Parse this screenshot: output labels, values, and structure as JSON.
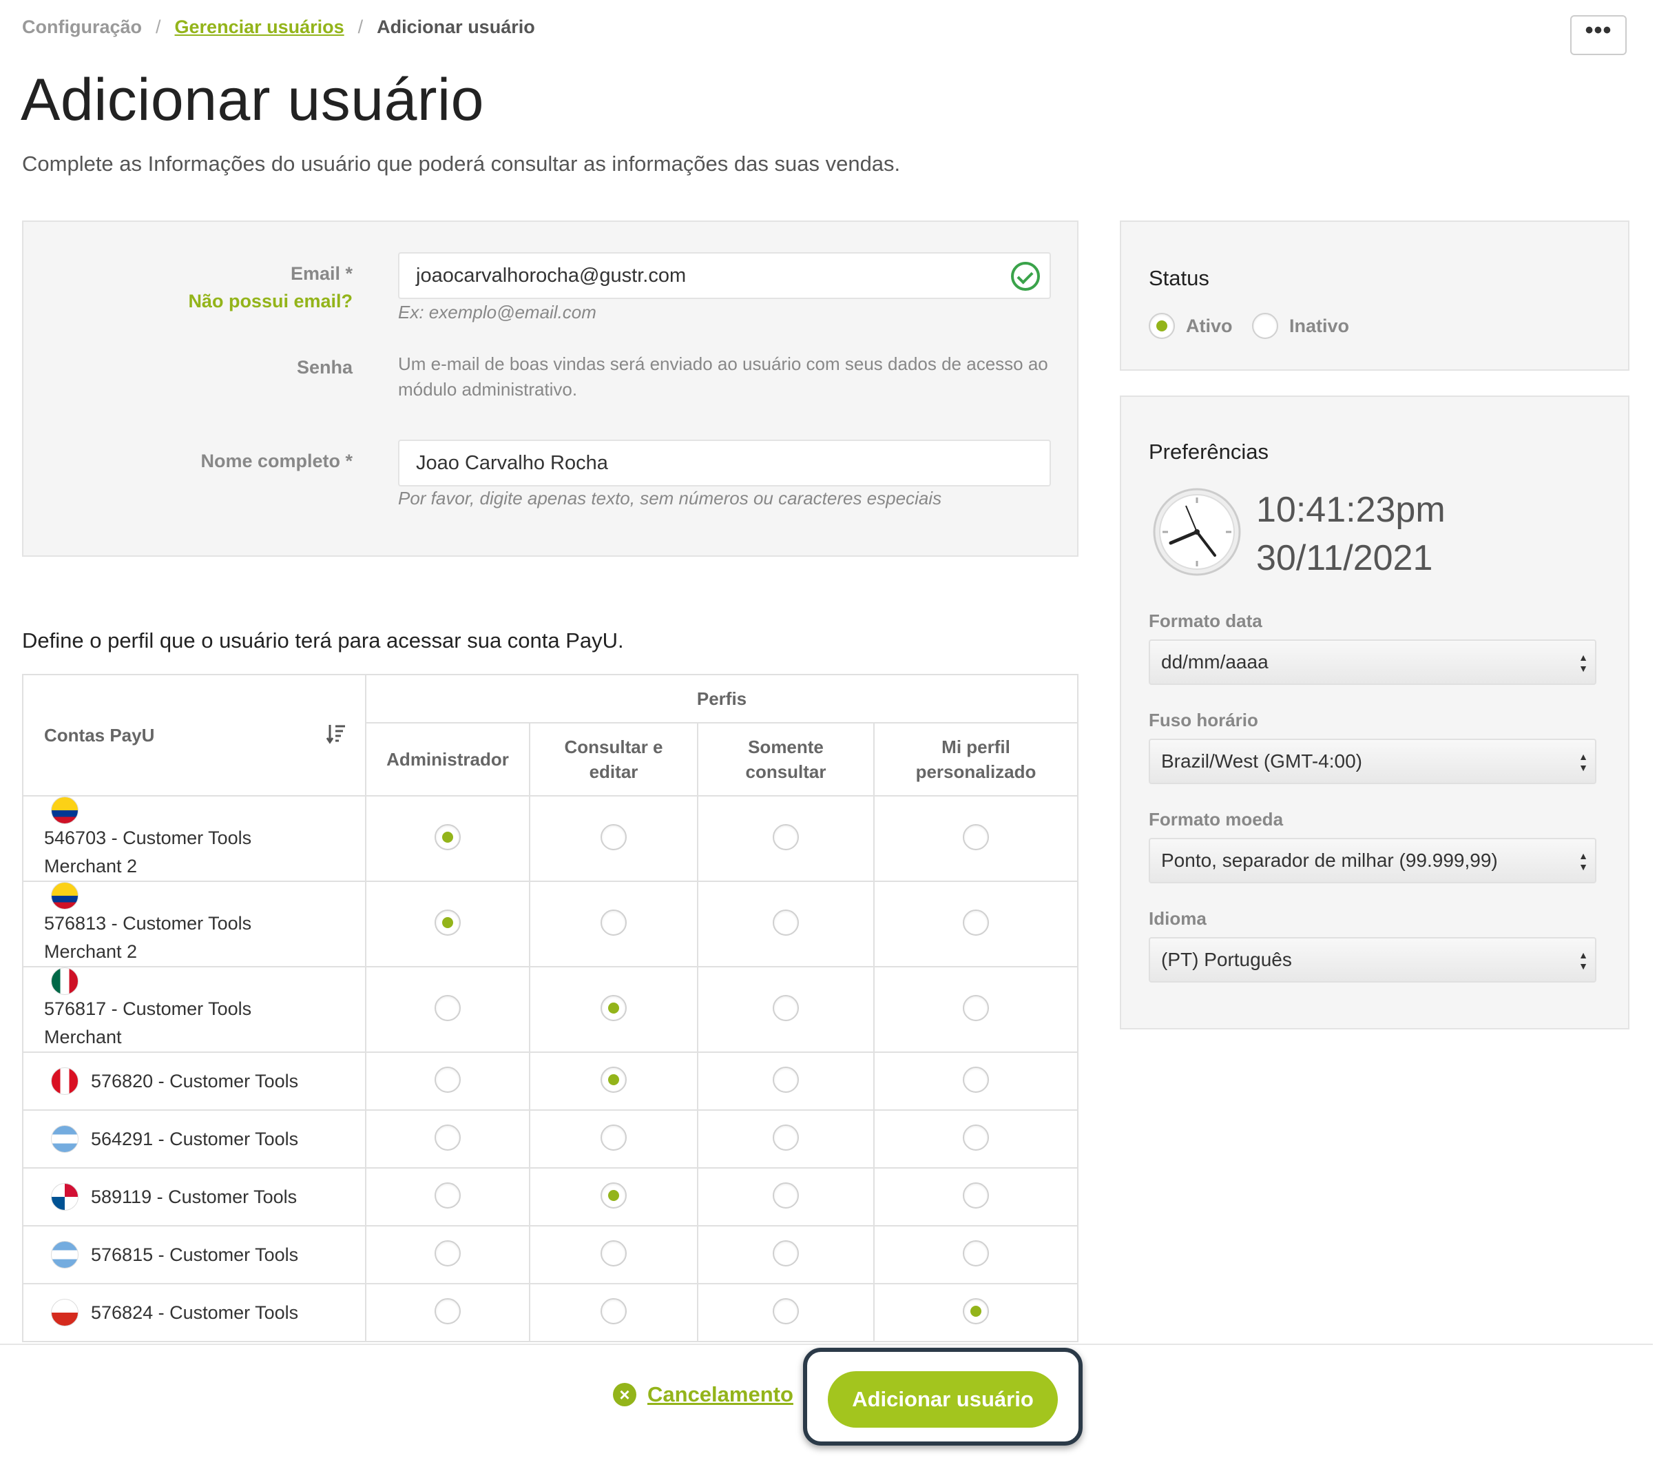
{
  "breadcrumb": {
    "items": [
      {
        "label": "Configuração",
        "type": "plain"
      },
      {
        "label": "Gerenciar usuários",
        "type": "link"
      },
      {
        "label": "Adicionar usuário",
        "type": "current"
      }
    ],
    "separator": "/"
  },
  "more_button": {
    "label": "•••"
  },
  "page": {
    "title": "Adicionar usuário",
    "subtitle": "Complete as Informações do usuário que poderá consultar as informações das suas vendas."
  },
  "form": {
    "email_label": "Email *",
    "no_email_link": "Não possui email?",
    "email_value": "joaocarvalhorocha@gustr.com",
    "email_hint": "Ex: exemplo@email.com",
    "password_label": "Senha",
    "password_info": "Um e-mail de boas vindas será enviado ao usuário com seus dados de acesso ao módulo administrativo.",
    "name_label": "Nome completo *",
    "name_value": "Joao Carvalho Rocha",
    "name_hint": "Por favor, digite apenas texto, sem números ou caracteres especiais"
  },
  "profiles": {
    "heading": "Define o perfil que o usuário terá para acessar sua conta PayU.",
    "accounts_header": "Contas PayU",
    "profiles_header": "Perfis",
    "columns": [
      "Administrador",
      "Consultar e editar",
      "Somente consultar",
      "Mi perfil personalizado"
    ],
    "rows": [
      {
        "account": "546703 - Customer Tools Merchant 2",
        "flag": "colombia",
        "selected": 0
      },
      {
        "account": "576813 - Customer Tools Merchant 2",
        "flag": "colombia",
        "selected": 0
      },
      {
        "account": "576817 - Customer Tools Merchant",
        "flag": "mexico",
        "selected": 1
      },
      {
        "account": "576820 - Customer Tools",
        "flag": "peru",
        "selected": 1
      },
      {
        "account": "564291 - Customer Tools",
        "flag": "argentina",
        "selected": -1
      },
      {
        "account": "589119 - Customer Tools",
        "flag": "panama",
        "selected": 1
      },
      {
        "account": "576815 - Customer Tools",
        "flag": "argentina",
        "selected": -1
      },
      {
        "account": "576824 - Customer Tools",
        "flag": "chile",
        "selected": 3
      }
    ]
  },
  "status": {
    "title": "Status",
    "options": [
      "Ativo",
      "Inativo"
    ],
    "selected": "Ativo"
  },
  "preferences": {
    "title": "Preferências",
    "time": "10:41:23pm",
    "date": "30/11/2021",
    "date_format_label": "Formato data",
    "date_format_value": "dd/mm/aaaa",
    "timezone_label": "Fuso horário",
    "timezone_value": "Brazil/West (GMT-4:00)",
    "currency_label": "Formato moeda",
    "currency_value": "Ponto, separador de milhar (99.999,99)",
    "language_label": "Idioma",
    "language_value": "(PT) Português"
  },
  "footer": {
    "cancel_label": "Cancelamento",
    "submit_label": "Adicionar usuário"
  },
  "colors": {
    "accent": "#93b41a",
    "button": "#a3c51e",
    "valid": "#3aa34a"
  }
}
